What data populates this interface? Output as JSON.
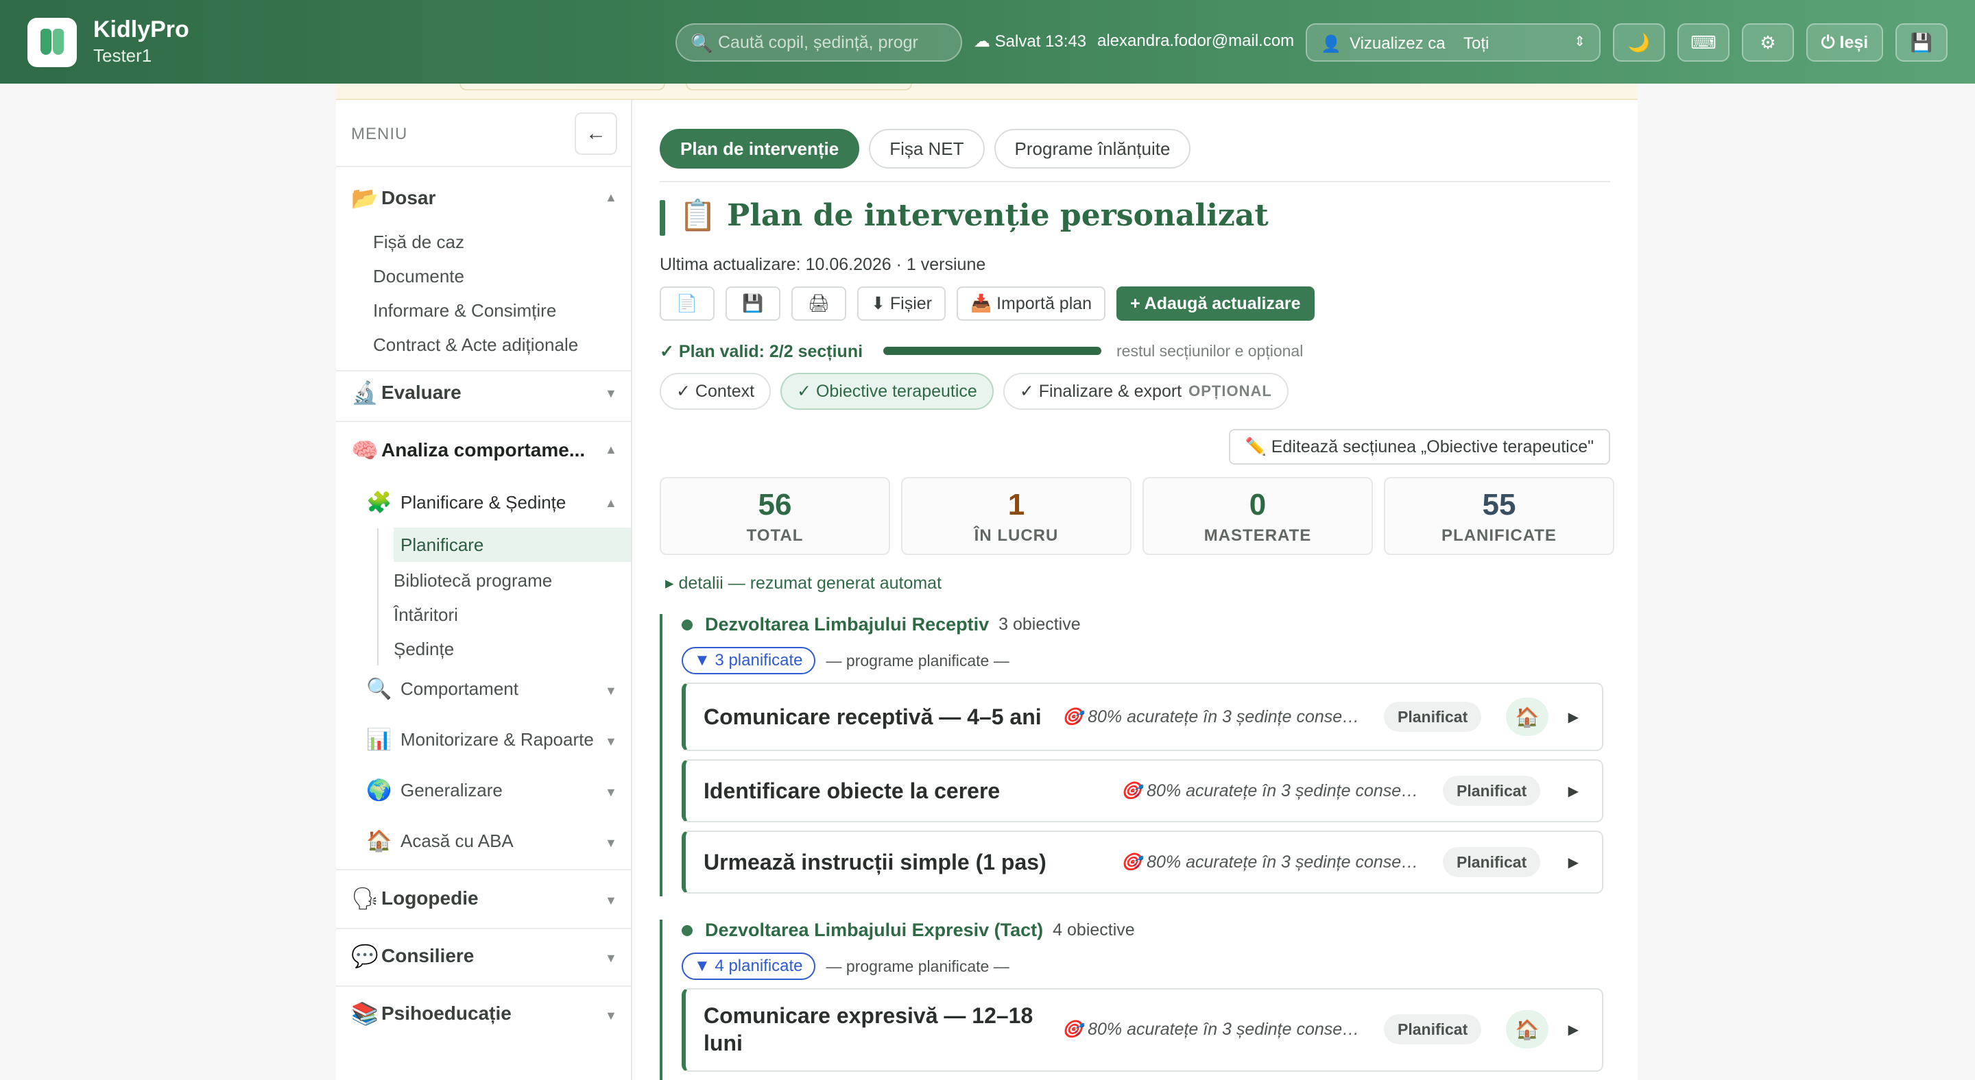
{
  "app": {
    "name": "KidlyPro",
    "user": "Tester1"
  },
  "topbar": {
    "search_placeholder": "Caută copil, ședință, progr",
    "saved": "Salvat 13:43",
    "email": "alexandra.fodor@mail.com",
    "view_as_label": "Vizualizez ca",
    "view_as_value": "Toți",
    "exit_label": "Ieși"
  },
  "sidebar": {
    "header": "MENIU",
    "sections": [
      {
        "icon": "📂",
        "label": "Dosar",
        "expanded": true,
        "items": [
          "Fișă de caz",
          "Documente",
          "Informare & Consimțire",
          "Contract & Acte adiționale"
        ]
      },
      {
        "icon": "🔬",
        "label": "Evaluare",
        "expanded": false
      },
      {
        "icon": "🧠",
        "label": "Analiza comportame...",
        "expanded": true
      },
      {
        "icon": "🗣",
        "label": "Logopedie",
        "expanded": false
      },
      {
        "icon": "💬",
        "label": "Consiliere",
        "expanded": false
      },
      {
        "icon": "📚",
        "label": "Psihoeducație",
        "expanded": false
      }
    ],
    "aba_subsections": [
      {
        "icon": "🧩",
        "label": "Planificare & Ședințe",
        "expanded": true,
        "items": [
          "Planificare",
          "Bibliotecă programe",
          "Întăritori",
          "Ședințe"
        ],
        "active_item": "Planificare"
      },
      {
        "icon": "🔍",
        "label": "Comportament"
      },
      {
        "icon": "📊",
        "label": "Monitorizare & Rapoarte"
      },
      {
        "icon": "🌍",
        "label": "Generalizare"
      },
      {
        "icon": "🏠",
        "label": "Acasă cu ABA"
      }
    ]
  },
  "main": {
    "tabs": [
      "Plan de intervenție",
      "Fișa NET",
      "Programe înlănțuite"
    ],
    "active_tab": "Plan de intervenție",
    "title": "Plan de intervenție personalizat",
    "title_icon": "📋",
    "updated": "Ultima actualizare: 10.06.2026 · 1 versiune",
    "actions": {
      "file_label": "⬇ Fișier",
      "import_label": "📥 Importă plan",
      "add_update_label": "+ Adaugă actualizare"
    },
    "validity": {
      "label": "✓ Plan valid: 2/2 secțiuni",
      "progress": 1.0,
      "note": "restul secțiunilor e opțional"
    },
    "section_chips": [
      {
        "label": "✓ Context",
        "selected": false
      },
      {
        "label": "✓ Obiective terapeutice",
        "selected": true
      },
      {
        "label": "✓ Finalizare & export",
        "optional": "OPȚIONAL",
        "selected": false
      }
    ],
    "edit_section_label": "✏️ Editează secțiunea „Obiective terapeutice\"",
    "stats": [
      {
        "value": "56",
        "label": "TOTAL",
        "color": "#2f6a47"
      },
      {
        "value": "1",
        "label": "ÎN LUCRU",
        "color": "#8a4b12"
      },
      {
        "value": "0",
        "label": "MASTERATE",
        "color": "#2f6a47"
      },
      {
        "value": "55",
        "label": "PLANIFICATE",
        "color": "#3b4f62"
      }
    ],
    "details_label": "▸ detalii — rezumat generat automat",
    "groups": [
      {
        "name": "Dezvoltarea Limbajului Receptiv",
        "count": "3 obiective",
        "planned_pill": "▼ 3 planificate",
        "planned_note": "— programe planificate —",
        "objectives": [
          {
            "title": "Comunicare receptivă — 4–5 ani",
            "criterion": "80% acuratețe în 3 ședințe conse…",
            "status": "Planificat",
            "home": true
          },
          {
            "title": "Identificare obiecte la cerere",
            "criterion": "80% acuratețe în 3 ședințe conse…",
            "status": "Planificat",
            "home": false
          },
          {
            "title": "Urmează instrucții simple (1 pas)",
            "criterion": "80% acuratețe în 3 ședințe conse…",
            "status": "Planificat",
            "home": false
          }
        ]
      },
      {
        "name": "Dezvoltarea Limbajului Expresiv (Tact)",
        "count": "4 obiective",
        "planned_pill": "▼ 4 planificate",
        "planned_note": "— programe planificate —",
        "objectives": [
          {
            "title": "Comunicare expresivă — 12–18 luni",
            "criterion": "80% acuratețe în 3 ședințe conse…",
            "status": "Planificat",
            "home": true
          }
        ]
      }
    ]
  }
}
